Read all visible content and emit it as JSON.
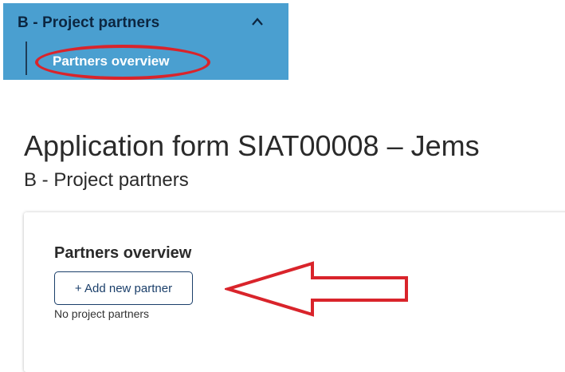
{
  "nav": {
    "section_label": "B - Project partners",
    "item_label": "Partners overview",
    "chevron_icon": "chevron-up-icon"
  },
  "page": {
    "title": "Application form SIAT00008 – Jems",
    "subtitle": "B - Project partners"
  },
  "card": {
    "title": "Partners overview",
    "add_button_label": "+ Add new partner",
    "empty_text": "No project partners"
  },
  "annotation": {
    "highlight_color": "#d9242b",
    "arrow_icon": "left-arrow-annotation"
  },
  "colors": {
    "nav_background": "#4a9fd0",
    "button_border": "#1b3f6a"
  }
}
